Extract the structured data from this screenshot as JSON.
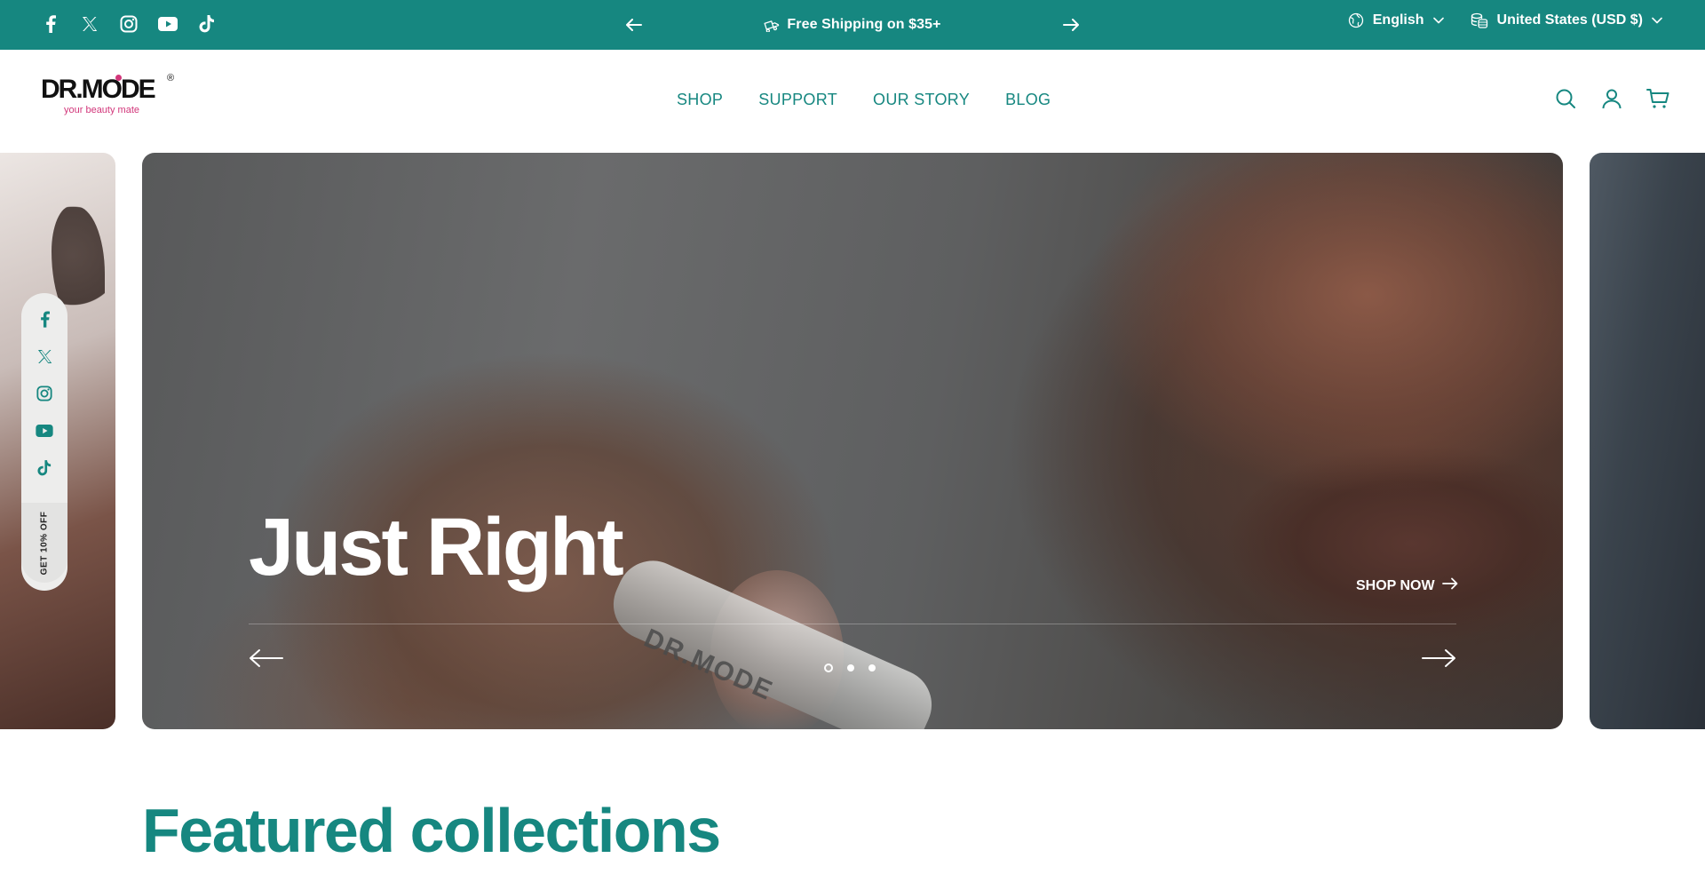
{
  "topbar": {
    "social_icons": [
      "facebook-icon",
      "x-icon",
      "instagram-icon",
      "youtube-icon",
      "tiktok-icon"
    ],
    "announcement": "Free Shipping on $35+",
    "language": "English",
    "currency": "United States (USD $)",
    "bg_color": "#168780"
  },
  "header": {
    "logo_text": "DR.MODE",
    "logo_tagline": "your beauty mate",
    "nav": [
      "SHOP",
      "SUPPORT",
      "OUR STORY",
      "BLOG"
    ],
    "icons": [
      "search-icon",
      "account-icon",
      "cart-icon"
    ]
  },
  "hero": {
    "heading": "Just Right",
    "cta": "SHOP NOW",
    "bottle_text": "DR.MODE",
    "slide_count": 3,
    "active_slide": 1
  },
  "floating_social": {
    "icons": [
      "facebook-icon",
      "x-icon",
      "instagram-icon",
      "youtube-icon",
      "tiktok-icon"
    ],
    "offer": "GET 10% OFF"
  },
  "featured": {
    "title": "Featured collections"
  },
  "colors": {
    "accent": "#168780",
    "brand_pink": "#d2367a"
  }
}
